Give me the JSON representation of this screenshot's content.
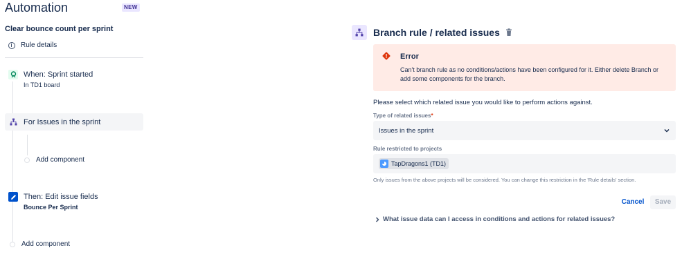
{
  "app": {
    "title": "Automation",
    "badge": "NEW"
  },
  "rule": {
    "name": "Clear bounce count per sprint",
    "details_label": "Rule details"
  },
  "steps": {
    "trigger": {
      "title": "When: Sprint started",
      "subtitle": "In TD1 board",
      "icon": "trigger-icon"
    },
    "branch": {
      "title": "For Issues in the sprint",
      "icon": "branch-icon"
    },
    "branch_add_component": "Add component",
    "action": {
      "title": "Then: Edit issue fields",
      "subtitle": "Bounce Per Sprint",
      "icon": "pencil-icon"
    },
    "add_component": "Add component"
  },
  "panel": {
    "title": "Branch rule / related issues",
    "error": {
      "title": "Error",
      "message": "Can't branch rule as no conditions/actions have been configured for it. Either delete Branch or add some components for the branch."
    },
    "instruction": "Please select which related issue you would like to perform actions against.",
    "type_field": {
      "label": "Type of related issues",
      "required_marker": "*",
      "value": "Issues in the sprint"
    },
    "projects_field": {
      "label": "Rule restricted to projects",
      "tag": "TapDragons1 (TD1)"
    },
    "help_text": "Only issues from the above projects will be considered. You can change this restriction in the 'Rule details' section.",
    "cancel_label": "Cancel",
    "save_label": "Save",
    "faq": "What issue data can I access in conditions and actions for related issues?"
  },
  "colors": {
    "text": "#172B4D",
    "link": "#0052CC",
    "error_bg": "#FFEBE6",
    "error_icon": "#DE350B",
    "branch_bg": "#EAE6FF",
    "branch_icon": "#5243AA",
    "trigger_bg": "#E3FCEF",
    "trigger_icon": "#00875A",
    "action_icon": "#0052CC"
  }
}
